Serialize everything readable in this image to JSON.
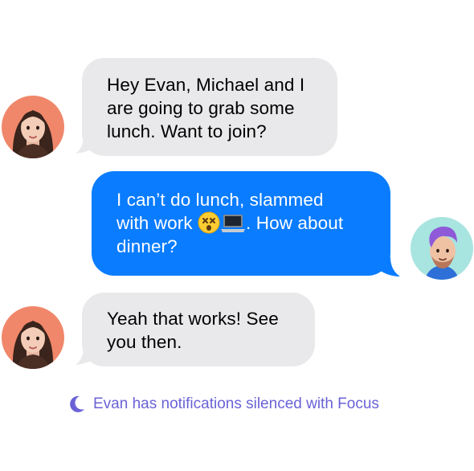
{
  "conversation": {
    "messages": [
      {
        "sender": "incoming",
        "lines": [
          "Hey Evan, Michael and I",
          "are going to grab some",
          "lunch. Want to join?"
        ]
      },
      {
        "sender": "outgoing",
        "line1": "I can’t do lunch, slammed",
        "line2_pre": "with work",
        "line2_post": ". How about",
        "line3": "dinner?",
        "emoji_icons": [
          "dizzy-face-emoji-icon",
          "laptop-emoji-icon"
        ]
      },
      {
        "sender": "incoming",
        "lines": [
          "Yeah that works! See",
          "you then."
        ]
      }
    ]
  },
  "focus_notice": {
    "icon": "moon-icon",
    "text": "Evan has notifications silenced with Focus",
    "color": "#6a62d6"
  },
  "colors": {
    "incoming_bubble": "#e9e9eb",
    "outgoing_bubble": "#0a7cff",
    "left_avatar_bg": "#f0876a",
    "right_avatar_bg": "#a8e4e0"
  }
}
